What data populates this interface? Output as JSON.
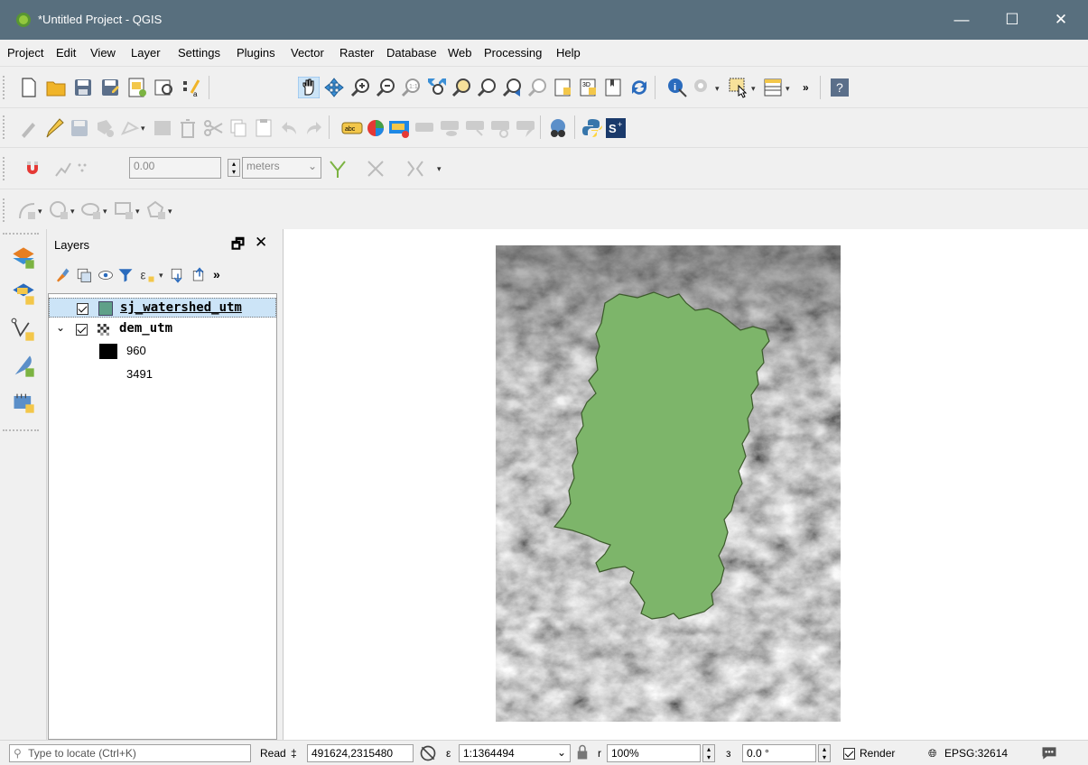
{
  "window": {
    "title": "*Untitled Project - QGIS",
    "min_glyph": "—",
    "max_glyph": "☐",
    "close_glyph": "✕"
  },
  "menu": [
    "Project",
    "Edit",
    "View",
    "Layer",
    "Settings",
    "Plugins",
    "Vector",
    "Raster",
    "Database",
    "Web",
    "Processing",
    "Help"
  ],
  "toolbar_snapping": {
    "tolerance_value": "0.00",
    "units": "meters"
  },
  "layers_panel": {
    "title": "Layers",
    "float_glyph": "🗗",
    "close_glyph": "✕",
    "more_glyph": "»",
    "layers": [
      {
        "name": "sj_watershed_utm",
        "checked": true,
        "color": "#5fa088"
      },
      {
        "name": "dem_utm",
        "checked": true,
        "expanded": true
      }
    ],
    "legend": [
      {
        "label": "960",
        "color": "#000000"
      },
      {
        "label": "3491",
        "color": "#ffffff"
      }
    ]
  },
  "status": {
    "locate_placeholder": "Type to locate (Ctrl+K)",
    "read_label": "Read",
    "coord_label": "‡",
    "coordinate": "491624,2315480",
    "scale_label": "ε",
    "scale": "1:1364494",
    "magnifier_label": "r",
    "magnifier": "100%",
    "rotation_label": "з",
    "rotation": "0.0 °",
    "render_label": "Render",
    "render_checked": true,
    "crs": "EPSG:32614"
  },
  "colors": {
    "titlebar": "#586f7e",
    "watershed_fill": "#7db56a",
    "watershed_stroke": "#3b5a2a"
  }
}
